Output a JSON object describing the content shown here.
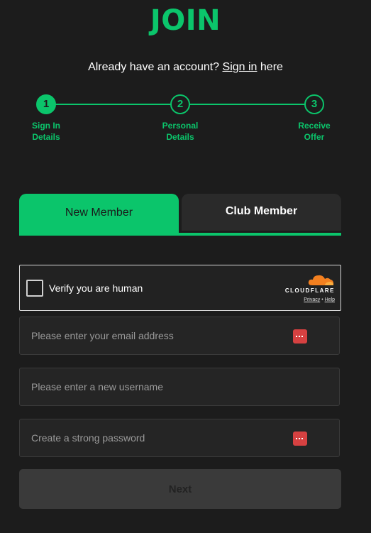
{
  "page": {
    "title": "JOIN",
    "accent_color": "#0bc56b"
  },
  "signin": {
    "prefix": "Already have an account?",
    "link": "Sign in",
    "suffix": "here"
  },
  "steps": [
    {
      "number": "1",
      "label": "Sign In\nDetails",
      "active": true
    },
    {
      "number": "2",
      "label": "Personal\nDetails",
      "active": false
    },
    {
      "number": "3",
      "label": "Receive\nOffer",
      "active": false
    }
  ],
  "tabs": {
    "new_member": "New Member",
    "club_member": "Club Member",
    "selected": "New Member"
  },
  "captcha": {
    "label": "Verify you are human",
    "brand": "CLOUDFLARE",
    "privacy": "Privacy",
    "separator": "•",
    "help": "Help"
  },
  "form": {
    "email_placeholder": "Please enter your email address",
    "username_placeholder": "Please enter a new username",
    "password_placeholder": "Create a strong password",
    "password_manager_icon": "password-manager-icon"
  },
  "next_button": "Next"
}
